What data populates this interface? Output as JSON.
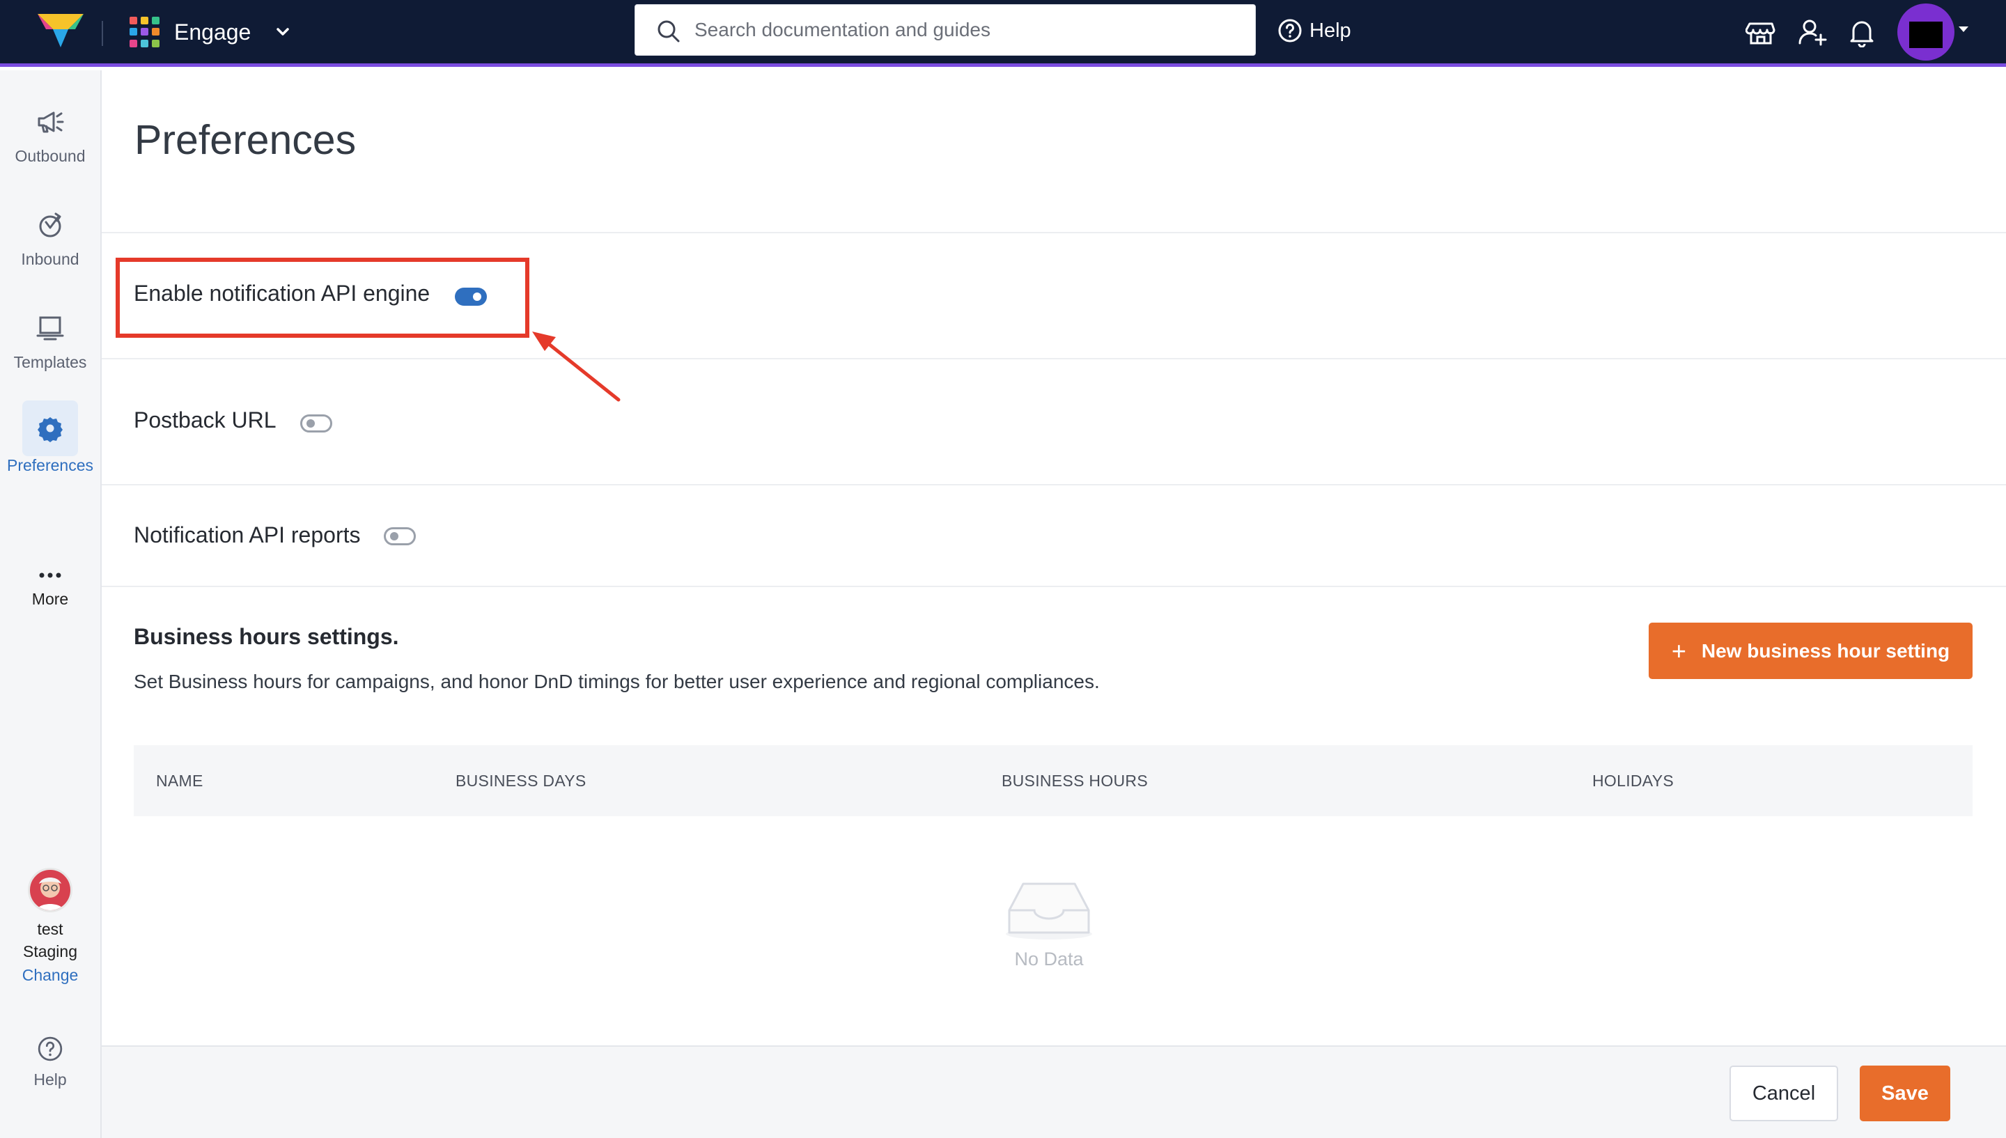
{
  "topbar": {
    "product_name": "Engage",
    "search_placeholder": "Search documentation and guides",
    "help_label": "Help",
    "accent_color": "#7b4de0",
    "icons": [
      "logo",
      "apps-grid-icon",
      "chevron-down-icon",
      "search-icon",
      "help-circle-icon",
      "store-icon",
      "add-user-icon",
      "bell-icon",
      "avatar"
    ]
  },
  "sidebar": {
    "items": [
      {
        "label": "Outbound",
        "icon": "megaphone-icon"
      },
      {
        "label": "Inbound",
        "icon": "inbound-icon"
      },
      {
        "label": "Templates",
        "icon": "template-icon"
      },
      {
        "label": "Preferences",
        "icon": "gear-icon",
        "active": true
      },
      {
        "label": "More",
        "icon": "more-dots-icon"
      }
    ],
    "user": {
      "name": "test",
      "env": "Staging",
      "change_label": "Change"
    },
    "help_label": "Help"
  },
  "main": {
    "title": "Preferences",
    "preferences": [
      {
        "label": "Enable notification API engine",
        "enabled": true
      },
      {
        "label": "Postback URL",
        "enabled": false
      },
      {
        "label": "Notification API reports",
        "enabled": false
      }
    ],
    "business_hours": {
      "title": "Business hours settings.",
      "description": "Set Business hours for campaigns, and honor DnD timings for better user experience and regional compliances.",
      "new_button_label": "New business hour setting",
      "columns": [
        "NAME",
        "BUSINESS DAYS",
        "BUSINESS HOURS",
        "HOLIDAYS"
      ],
      "empty_label": "No Data"
    }
  },
  "footer": {
    "cancel_label": "Cancel",
    "save_label": "Save"
  },
  "colors": {
    "topbar_bg": "#0f1b35",
    "primary_orange": "#e86d2b",
    "toggle_on": "#2f6fbf",
    "highlight_red": "#e53a2a"
  }
}
